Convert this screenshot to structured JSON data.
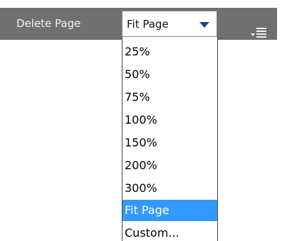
{
  "toolbar": {
    "delete_label": "Delete Page",
    "zoom_value": "Fit Page",
    "menu_icon": "menu-lines-icon"
  },
  "zoom_menu": {
    "options": [
      "25%",
      "50%",
      "75%",
      "100%",
      "150%",
      "200%",
      "300%",
      "Fit Page",
      "Custom..."
    ],
    "selected": "Fit Page"
  },
  "colors": {
    "toolbar_bg": "#707070",
    "selection": "#3399ff",
    "arrow": "#1f3f9a"
  }
}
